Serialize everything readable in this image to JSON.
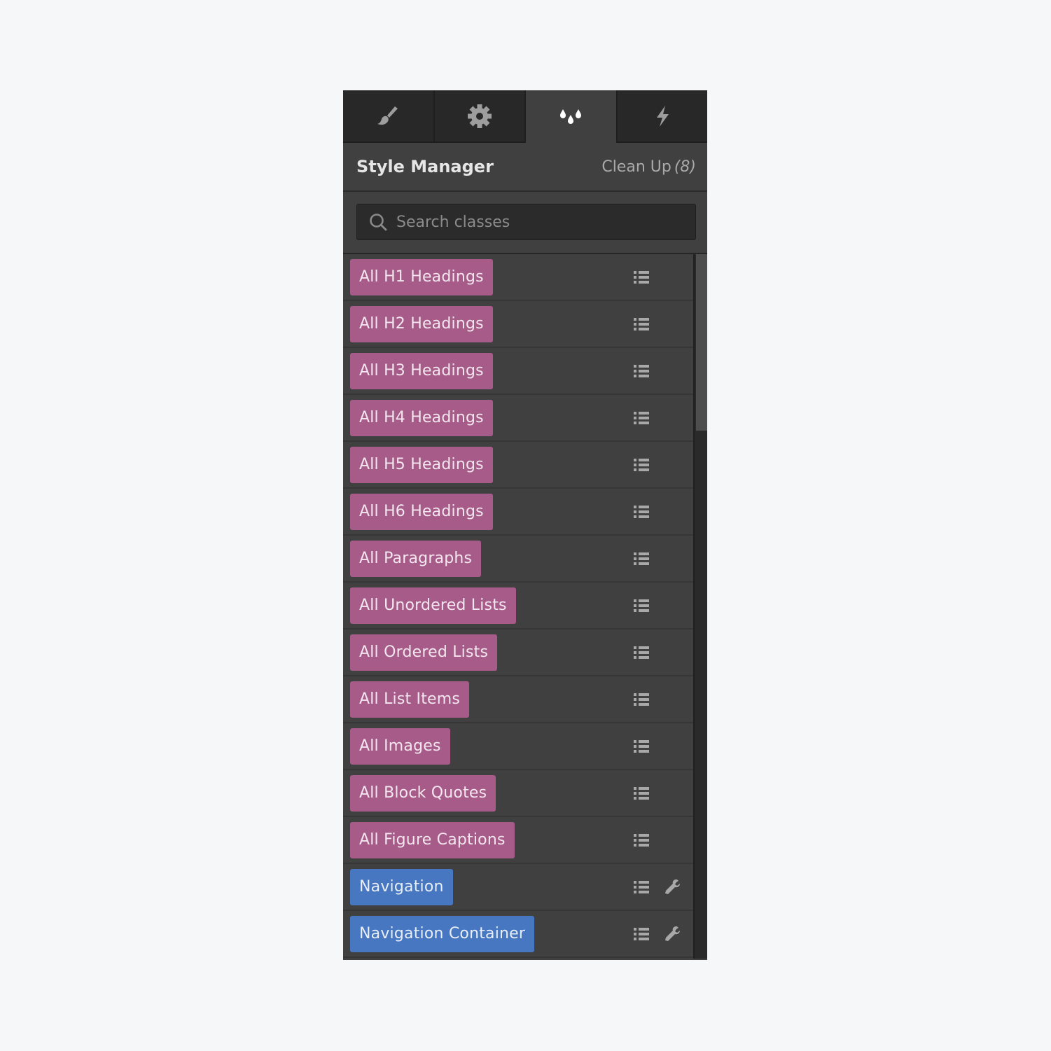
{
  "tabs": [
    {
      "name": "style",
      "icon": "paintbrush-icon",
      "active": false
    },
    {
      "name": "settings",
      "icon": "gear-icon",
      "active": false
    },
    {
      "name": "style-manager",
      "icon": "droplets-icon",
      "active": true
    },
    {
      "name": "interactions",
      "icon": "lightning-icon",
      "active": false
    }
  ],
  "header": {
    "title": "Style Manager",
    "cleanup_label": "Clean Up",
    "cleanup_count": "(8)"
  },
  "search": {
    "placeholder": "Search classes",
    "value": ""
  },
  "colors": {
    "tag_element": "#a75b89",
    "tag_class": "#4677c0"
  },
  "classes": [
    {
      "label": "All H1 Headings",
      "type": "element",
      "has_wrench": false
    },
    {
      "label": "All H2 Headings",
      "type": "element",
      "has_wrench": false
    },
    {
      "label": "All H3 Headings",
      "type": "element",
      "has_wrench": false
    },
    {
      "label": "All H4 Headings",
      "type": "element",
      "has_wrench": false
    },
    {
      "label": "All H5 Headings",
      "type": "element",
      "has_wrench": false
    },
    {
      "label": "All H6 Headings",
      "type": "element",
      "has_wrench": false
    },
    {
      "label": "All Paragraphs",
      "type": "element",
      "has_wrench": false
    },
    {
      "label": "All Unordered Lists",
      "type": "element",
      "has_wrench": false
    },
    {
      "label": "All Ordered Lists",
      "type": "element",
      "has_wrench": false
    },
    {
      "label": "All List Items",
      "type": "element",
      "has_wrench": false
    },
    {
      "label": "All Images",
      "type": "element",
      "has_wrench": false
    },
    {
      "label": "All Block Quotes",
      "type": "element",
      "has_wrench": false
    },
    {
      "label": "All Figure Captions",
      "type": "element",
      "has_wrench": false
    },
    {
      "label": "Navigation",
      "type": "class",
      "has_wrench": true
    },
    {
      "label": "Navigation Container",
      "type": "class",
      "has_wrench": true
    }
  ],
  "scrollbar": {
    "position_fraction": 0.0,
    "visible_fraction": 0.25
  }
}
